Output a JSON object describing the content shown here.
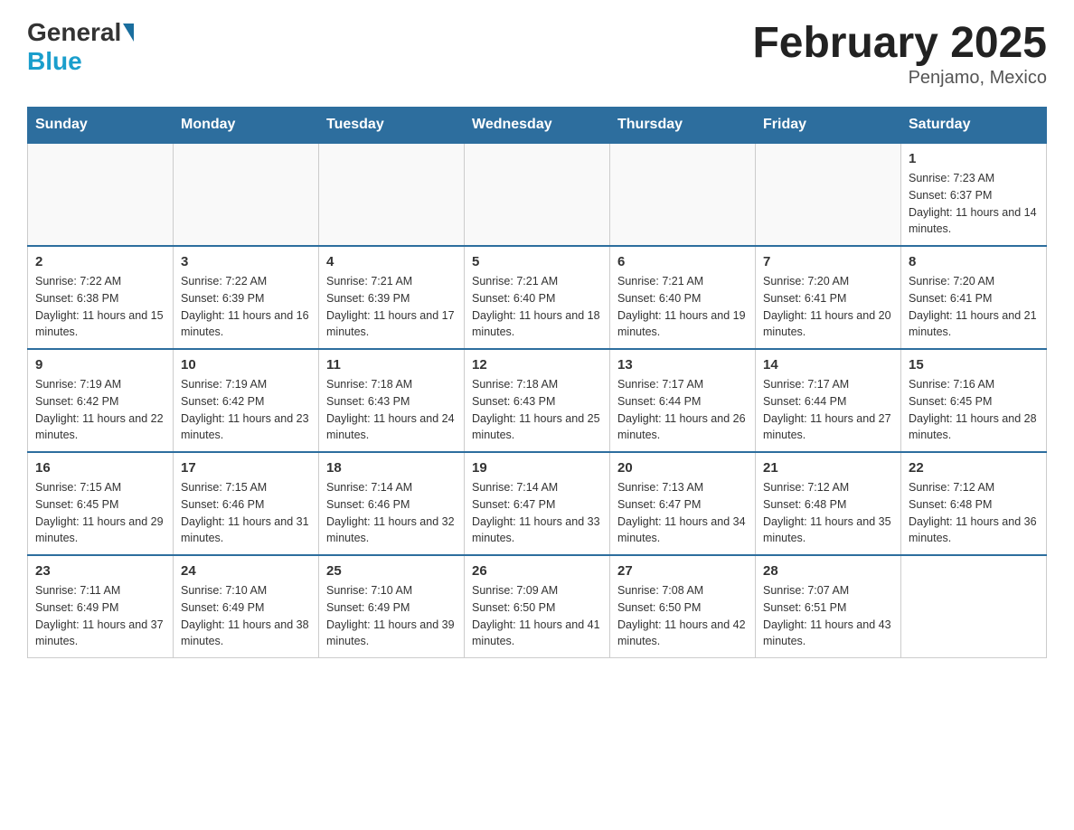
{
  "header": {
    "logo_general": "General",
    "logo_blue": "Blue",
    "month_title": "February 2025",
    "location": "Penjamo, Mexico"
  },
  "weekdays": [
    "Sunday",
    "Monday",
    "Tuesday",
    "Wednesday",
    "Thursday",
    "Friday",
    "Saturday"
  ],
  "weeks": [
    [
      {
        "day": "",
        "sunrise": "",
        "sunset": "",
        "daylight": ""
      },
      {
        "day": "",
        "sunrise": "",
        "sunset": "",
        "daylight": ""
      },
      {
        "day": "",
        "sunrise": "",
        "sunset": "",
        "daylight": ""
      },
      {
        "day": "",
        "sunrise": "",
        "sunset": "",
        "daylight": ""
      },
      {
        "day": "",
        "sunrise": "",
        "sunset": "",
        "daylight": ""
      },
      {
        "day": "",
        "sunrise": "",
        "sunset": "",
        "daylight": ""
      },
      {
        "day": "1",
        "sunrise": "Sunrise: 7:23 AM",
        "sunset": "Sunset: 6:37 PM",
        "daylight": "Daylight: 11 hours and 14 minutes."
      }
    ],
    [
      {
        "day": "2",
        "sunrise": "Sunrise: 7:22 AM",
        "sunset": "Sunset: 6:38 PM",
        "daylight": "Daylight: 11 hours and 15 minutes."
      },
      {
        "day": "3",
        "sunrise": "Sunrise: 7:22 AM",
        "sunset": "Sunset: 6:39 PM",
        "daylight": "Daylight: 11 hours and 16 minutes."
      },
      {
        "day": "4",
        "sunrise": "Sunrise: 7:21 AM",
        "sunset": "Sunset: 6:39 PM",
        "daylight": "Daylight: 11 hours and 17 minutes."
      },
      {
        "day": "5",
        "sunrise": "Sunrise: 7:21 AM",
        "sunset": "Sunset: 6:40 PM",
        "daylight": "Daylight: 11 hours and 18 minutes."
      },
      {
        "day": "6",
        "sunrise": "Sunrise: 7:21 AM",
        "sunset": "Sunset: 6:40 PM",
        "daylight": "Daylight: 11 hours and 19 minutes."
      },
      {
        "day": "7",
        "sunrise": "Sunrise: 7:20 AM",
        "sunset": "Sunset: 6:41 PM",
        "daylight": "Daylight: 11 hours and 20 minutes."
      },
      {
        "day": "8",
        "sunrise": "Sunrise: 7:20 AM",
        "sunset": "Sunset: 6:41 PM",
        "daylight": "Daylight: 11 hours and 21 minutes."
      }
    ],
    [
      {
        "day": "9",
        "sunrise": "Sunrise: 7:19 AM",
        "sunset": "Sunset: 6:42 PM",
        "daylight": "Daylight: 11 hours and 22 minutes."
      },
      {
        "day": "10",
        "sunrise": "Sunrise: 7:19 AM",
        "sunset": "Sunset: 6:42 PM",
        "daylight": "Daylight: 11 hours and 23 minutes."
      },
      {
        "day": "11",
        "sunrise": "Sunrise: 7:18 AM",
        "sunset": "Sunset: 6:43 PM",
        "daylight": "Daylight: 11 hours and 24 minutes."
      },
      {
        "day": "12",
        "sunrise": "Sunrise: 7:18 AM",
        "sunset": "Sunset: 6:43 PM",
        "daylight": "Daylight: 11 hours and 25 minutes."
      },
      {
        "day": "13",
        "sunrise": "Sunrise: 7:17 AM",
        "sunset": "Sunset: 6:44 PM",
        "daylight": "Daylight: 11 hours and 26 minutes."
      },
      {
        "day": "14",
        "sunrise": "Sunrise: 7:17 AM",
        "sunset": "Sunset: 6:44 PM",
        "daylight": "Daylight: 11 hours and 27 minutes."
      },
      {
        "day": "15",
        "sunrise": "Sunrise: 7:16 AM",
        "sunset": "Sunset: 6:45 PM",
        "daylight": "Daylight: 11 hours and 28 minutes."
      }
    ],
    [
      {
        "day": "16",
        "sunrise": "Sunrise: 7:15 AM",
        "sunset": "Sunset: 6:45 PM",
        "daylight": "Daylight: 11 hours and 29 minutes."
      },
      {
        "day": "17",
        "sunrise": "Sunrise: 7:15 AM",
        "sunset": "Sunset: 6:46 PM",
        "daylight": "Daylight: 11 hours and 31 minutes."
      },
      {
        "day": "18",
        "sunrise": "Sunrise: 7:14 AM",
        "sunset": "Sunset: 6:46 PM",
        "daylight": "Daylight: 11 hours and 32 minutes."
      },
      {
        "day": "19",
        "sunrise": "Sunrise: 7:14 AM",
        "sunset": "Sunset: 6:47 PM",
        "daylight": "Daylight: 11 hours and 33 minutes."
      },
      {
        "day": "20",
        "sunrise": "Sunrise: 7:13 AM",
        "sunset": "Sunset: 6:47 PM",
        "daylight": "Daylight: 11 hours and 34 minutes."
      },
      {
        "day": "21",
        "sunrise": "Sunrise: 7:12 AM",
        "sunset": "Sunset: 6:48 PM",
        "daylight": "Daylight: 11 hours and 35 minutes."
      },
      {
        "day": "22",
        "sunrise": "Sunrise: 7:12 AM",
        "sunset": "Sunset: 6:48 PM",
        "daylight": "Daylight: 11 hours and 36 minutes."
      }
    ],
    [
      {
        "day": "23",
        "sunrise": "Sunrise: 7:11 AM",
        "sunset": "Sunset: 6:49 PM",
        "daylight": "Daylight: 11 hours and 37 minutes."
      },
      {
        "day": "24",
        "sunrise": "Sunrise: 7:10 AM",
        "sunset": "Sunset: 6:49 PM",
        "daylight": "Daylight: 11 hours and 38 minutes."
      },
      {
        "day": "25",
        "sunrise": "Sunrise: 7:10 AM",
        "sunset": "Sunset: 6:49 PM",
        "daylight": "Daylight: 11 hours and 39 minutes."
      },
      {
        "day": "26",
        "sunrise": "Sunrise: 7:09 AM",
        "sunset": "Sunset: 6:50 PM",
        "daylight": "Daylight: 11 hours and 41 minutes."
      },
      {
        "day": "27",
        "sunrise": "Sunrise: 7:08 AM",
        "sunset": "Sunset: 6:50 PM",
        "daylight": "Daylight: 11 hours and 42 minutes."
      },
      {
        "day": "28",
        "sunrise": "Sunrise: 7:07 AM",
        "sunset": "Sunset: 6:51 PM",
        "daylight": "Daylight: 11 hours and 43 minutes."
      },
      {
        "day": "",
        "sunrise": "",
        "sunset": "",
        "daylight": ""
      }
    ]
  ]
}
